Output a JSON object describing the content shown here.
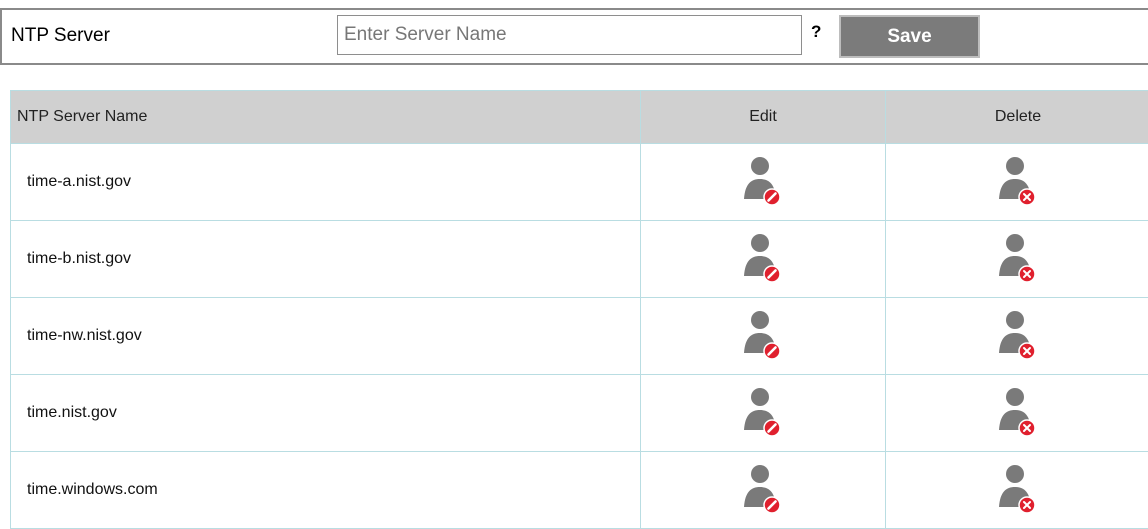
{
  "form": {
    "label": "NTP Server",
    "input_placeholder": "Enter Server Name",
    "input_value": "",
    "help": "?",
    "save_label": "Save"
  },
  "table": {
    "headers": [
      "NTP Server Name",
      "Edit",
      "Delete"
    ],
    "rows": [
      {
        "name": "time-a.nist.gov"
      },
      {
        "name": "time-b.nist.gov"
      },
      {
        "name": "time-nw.nist.gov"
      },
      {
        "name": "time.nist.gov"
      },
      {
        "name": "time.windows.com"
      }
    ]
  },
  "icons": {
    "edit": "user-edit-icon",
    "delete": "user-delete-icon"
  },
  "colors": {
    "icon_gray": "#7a7a7a",
    "badge_red": "#e0202e",
    "header_bg": "#d0d0d0",
    "grid_line": "#b9dde2",
    "save_bg": "#7b7b7b"
  }
}
